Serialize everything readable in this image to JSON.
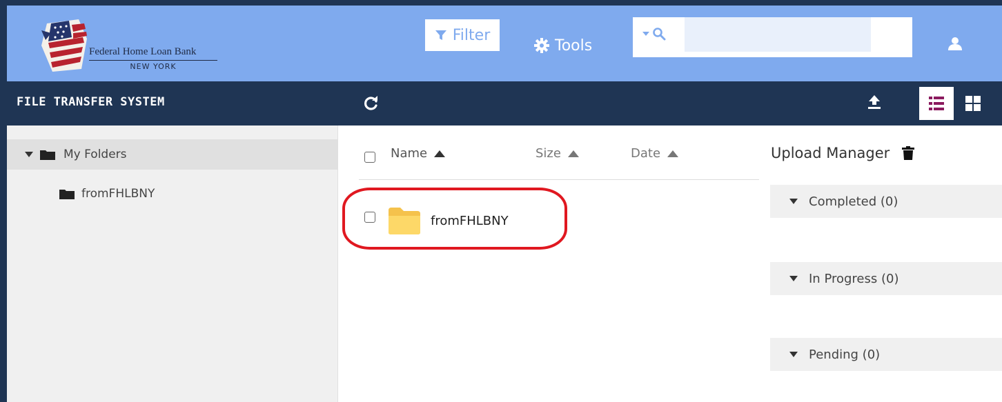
{
  "header": {
    "logo": {
      "name": "Federal Home Loan Bank",
      "subtitle": "NEW YORK"
    },
    "filter_label": "Filter",
    "tools_label": "Tools",
    "search": {
      "value": "",
      "placeholder": ""
    }
  },
  "toolbar": {
    "app_title": "FILE TRANSFER SYSTEM"
  },
  "sidebar": {
    "root": {
      "label": "My Folders",
      "expanded": true
    },
    "children": [
      {
        "label": "fromFHLBNY"
      }
    ]
  },
  "file_list": {
    "columns": [
      {
        "label": "Name",
        "sort": "ascending"
      },
      {
        "label": "Size",
        "sort": "ascending"
      },
      {
        "label": "Date",
        "sort": "ascending"
      }
    ],
    "rows": [
      {
        "name": "fromFHLBNY",
        "type": "folder",
        "checked": false
      }
    ]
  },
  "upload_manager": {
    "title": "Upload Manager",
    "sections": [
      {
        "label": "Completed (0)"
      },
      {
        "label": "In Progress (0)"
      },
      {
        "label": "Pending (0)"
      }
    ]
  },
  "colors": {
    "header_bg": "#7faaee",
    "toolbar_bg": "#1f3554",
    "highlight": "#e01820",
    "folder": "#f7c948",
    "list_view_icon": "#8b1a5e"
  },
  "icons": [
    "flag-logo",
    "filter-icon",
    "gear-icon",
    "search-icon",
    "user-icon",
    "refresh-icon",
    "upload-icon",
    "list-view-icon",
    "grid-view-icon",
    "caret-down-icon",
    "folder-icon",
    "sort-up-icon",
    "trash-icon"
  ]
}
